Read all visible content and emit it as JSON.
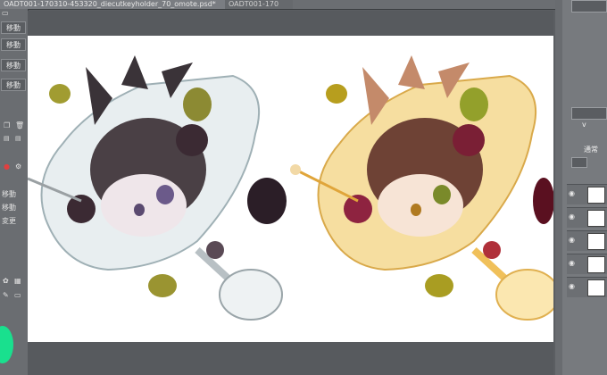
{
  "tabs": [
    {
      "label": "OADT001-170310-453320_diecutkeyholder_70_omote.psd*",
      "active": true
    },
    {
      "label": "OADT001-170",
      "active": false
    }
  ],
  "left_panel": {
    "buttons": [
      "移動",
      "移動",
      "移動",
      "移動"
    ],
    "lower_labels": [
      "移動",
      "移動",
      "変更"
    ]
  },
  "right_panel": {
    "labels": [
      "v",
      "通常"
    ],
    "layer_count": 6
  },
  "canvas": {
    "background": "#ffffff",
    "artwork": [
      "chibi character in dessert glass - monochrome version",
      "chibi character in dessert glass - color version"
    ]
  },
  "colors": {
    "ui_dark": "#5b5e62",
    "panel": "#6a6d71",
    "accent_swatch": "#19e08e"
  }
}
